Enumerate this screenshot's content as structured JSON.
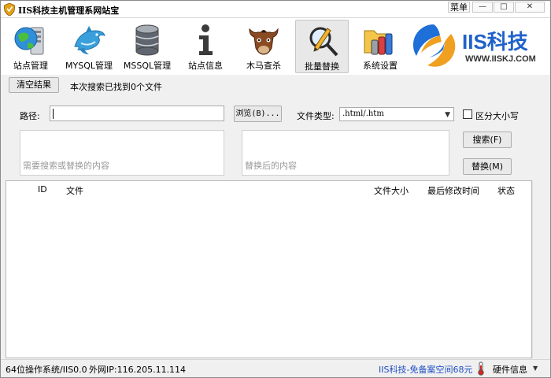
{
  "window": {
    "title": "IIS科技主机管理系网站宝",
    "menu_label": "菜单",
    "minimize": "—",
    "maximize": "□",
    "close": "✕"
  },
  "toolbar": {
    "items": [
      {
        "label": "站点管理",
        "icon": "globe-server-icon"
      },
      {
        "label": "MYSQL管理",
        "icon": "dolphin-icon"
      },
      {
        "label": "MSSQL管理",
        "icon": "database-icon"
      },
      {
        "label": "站点信息",
        "icon": "info-icon"
      },
      {
        "label": "木马查杀",
        "icon": "horse-icon"
      },
      {
        "label": "批量替换",
        "icon": "magnifier-pencil-icon"
      },
      {
        "label": "系统设置",
        "icon": "folder-settings-icon"
      }
    ],
    "active_index": 5
  },
  "brand": {
    "name": "IIS科技",
    "url": "WWW.IISKJ.COM"
  },
  "actions": {
    "clear_label": "清空结果",
    "result_text": "本次搜索已找到0个文件"
  },
  "form": {
    "path_label": "路径:",
    "path_value": "",
    "browse_label": "浏览(B)...",
    "type_label": "文件类型:",
    "type_value": ".html/.htm",
    "case_label": "区分大小写",
    "case_checked": false,
    "search_placeholder": "需要搜索或替换的内容",
    "replace_placeholder": "替换后的内容",
    "search_label": "搜索(F)",
    "replace_label": "替换(M)"
  },
  "table": {
    "columns": [
      "ID",
      "文件",
      "文件大小",
      "最后修改时间",
      "状态"
    ],
    "rows": []
  },
  "status": {
    "system": "64位操作系统/IIS0.0",
    "ip": "外网IP:116.205.11.114",
    "promo": "IIS科技-免备案空间68元",
    "hardware": "硬件信息",
    "dropdown": "▼"
  },
  "colors": {
    "brand_blue": "#1f62c9",
    "promo_blue": "#1f4fc4",
    "logo_orange": "#f0a020",
    "logo_blue": "#1e6fd8"
  }
}
